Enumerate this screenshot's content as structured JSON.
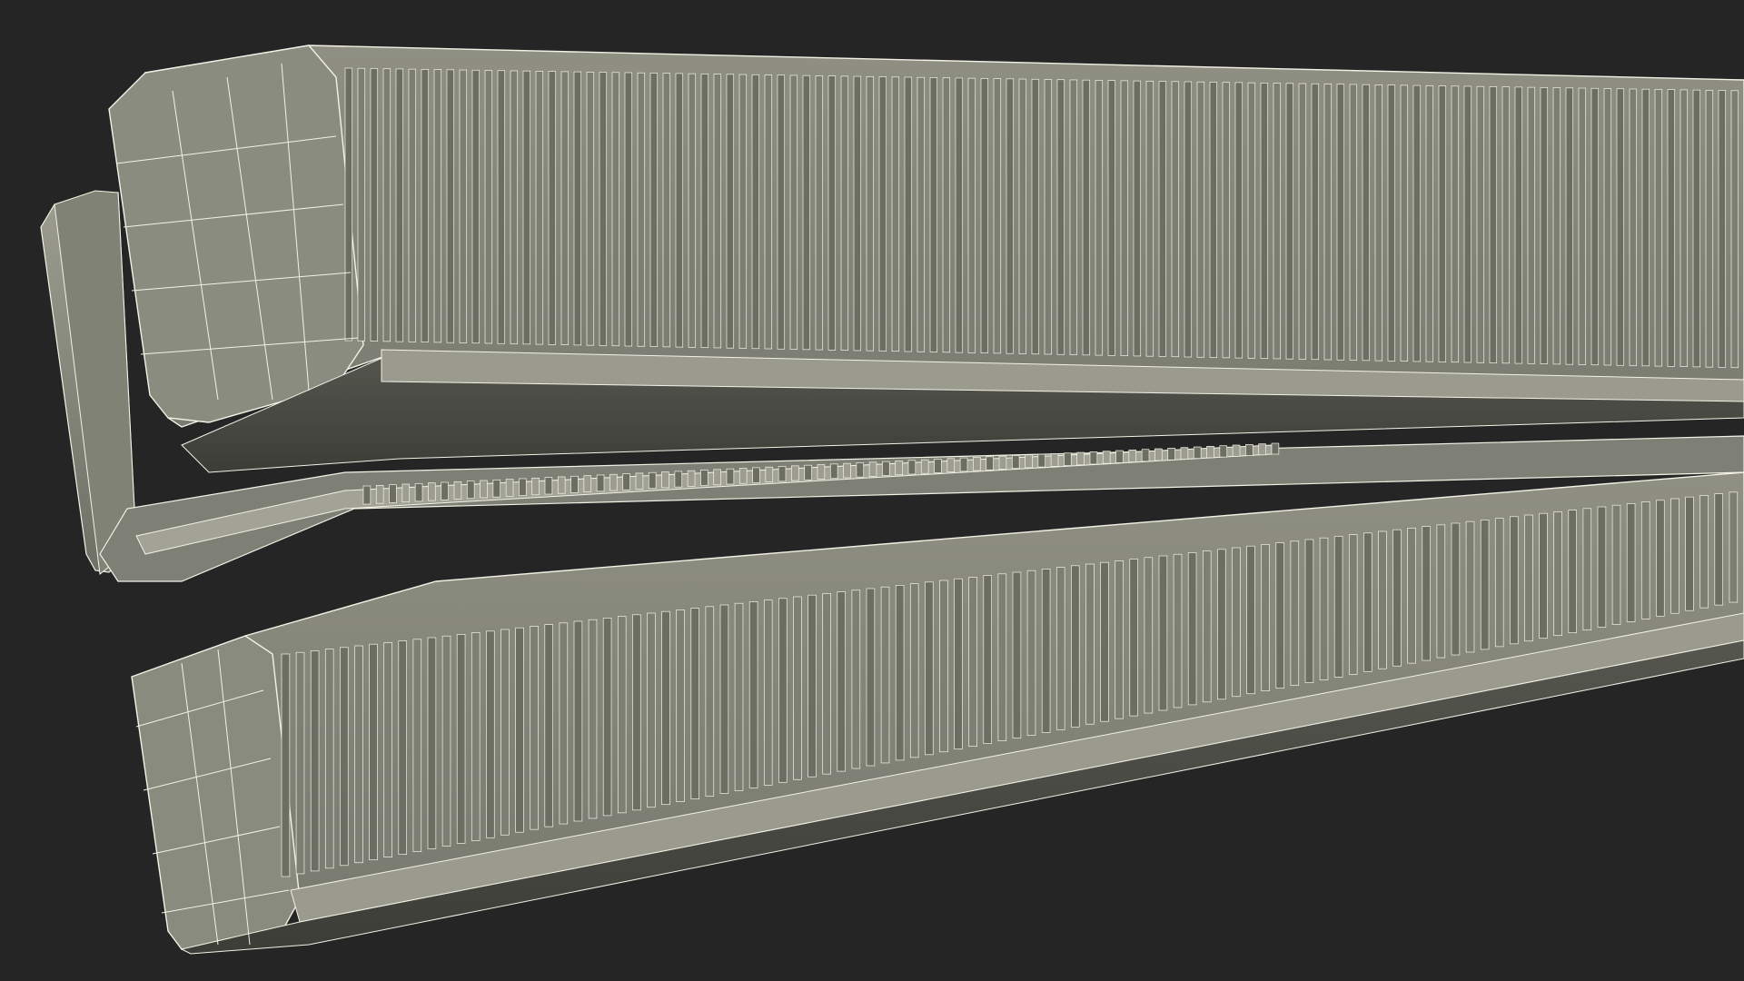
{
  "viewport": {
    "background_color": "#252525",
    "subject": "wireframe-3d-model",
    "shading_color": "#8a8b7e",
    "wire_color": "#f2f2e6",
    "shadow_color": "#4a4b44",
    "highlight_color": "#a9aa9c"
  }
}
